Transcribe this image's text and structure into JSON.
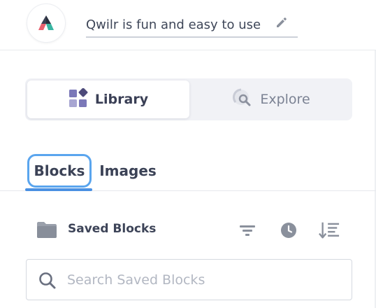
{
  "header": {
    "title": "Qwilr is fun and easy to use",
    "logo_icon": "qwilr-logo-icon",
    "edit_icon": "pencil-icon"
  },
  "toggle": {
    "library_label": "Library",
    "library_icon": "blocks-grid-icon",
    "explore_label": "Explore",
    "explore_icon": "explore-search-icon",
    "selected": "Library"
  },
  "tabs": {
    "items": [
      {
        "label": "Blocks",
        "active": true
      },
      {
        "label": "Images",
        "active": false
      }
    ]
  },
  "saved": {
    "label": "Saved Blocks",
    "folder_icon": "folder-icon",
    "controls": [
      "filter-icon",
      "clock-icon",
      "sort-icon"
    ]
  },
  "search": {
    "placeholder": "Search Saved Blocks",
    "value": "",
    "icon": "search-icon"
  },
  "colors": {
    "accent_blue": "#4a90e2",
    "focus_ring": "#5aa5ee",
    "icon_purple": "#7b78b8",
    "text_dark": "#3e4658",
    "icon_gray": "#8a909c"
  }
}
